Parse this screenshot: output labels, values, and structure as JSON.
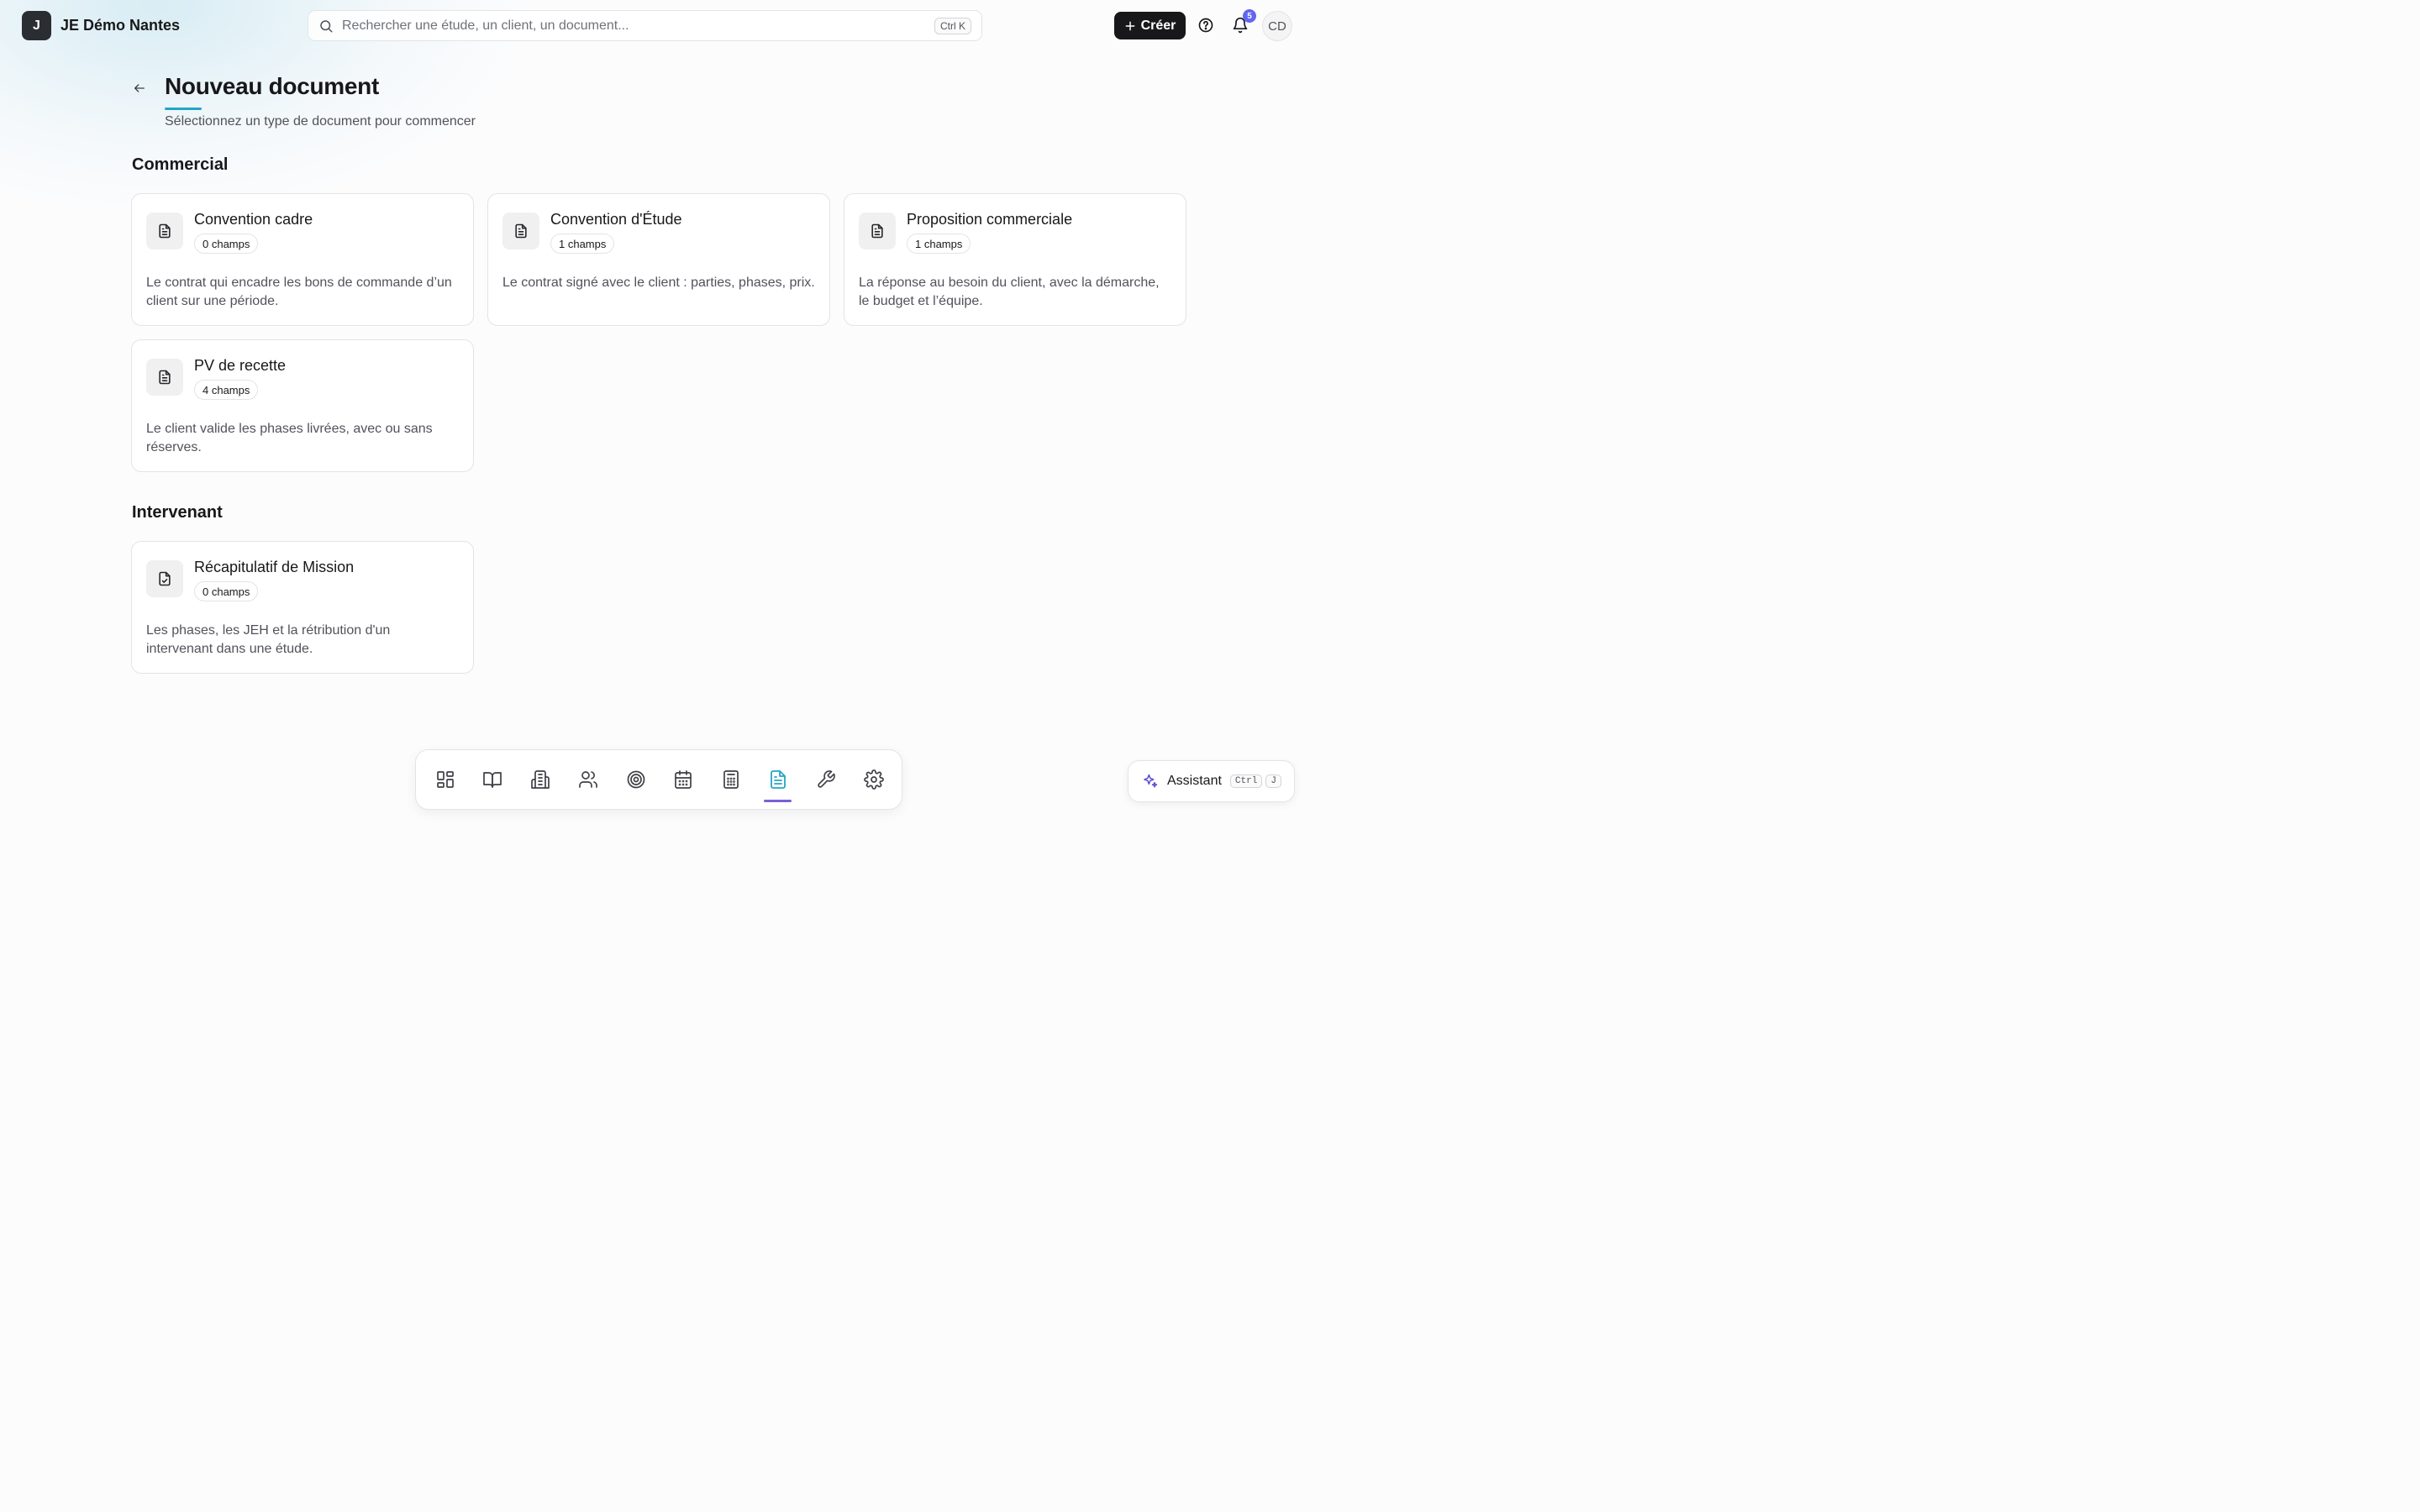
{
  "brand": {
    "logo_letter": "J",
    "name": "JE Démo Nantes"
  },
  "search": {
    "placeholder": "Rechercher une étude, un client, un document...",
    "shortcut": "Ctrl K"
  },
  "header": {
    "create_label": "Créer",
    "notifications_count": "5",
    "avatar_initials": "CD"
  },
  "page": {
    "title": "Nouveau document",
    "subtitle": "Sélectionnez un type de document pour commencer"
  },
  "sections": [
    {
      "title": "Commercial",
      "cards": [
        {
          "title": "Convention cadre",
          "badge": "0 champs",
          "description": "Le contrat qui encadre les bons de commande d’un client sur une période.",
          "icon": "file-text-icon"
        },
        {
          "title": "Convention d'Étude",
          "badge": "1 champs",
          "description": "Le contrat signé avec le client : parties, phases, prix.",
          "icon": "file-text-icon"
        },
        {
          "title": "Proposition commerciale",
          "badge": "1 champs",
          "description": "La réponse au besoin du client, avec la démarche, le budget et l’équipe.",
          "icon": "file-text-icon"
        },
        {
          "title": "PV de recette",
          "badge": "4 champs",
          "description": "Le client valide les phases livrées, avec ou sans réserves.",
          "icon": "file-text-icon"
        }
      ]
    },
    {
      "title": "Intervenant",
      "cards": [
        {
          "title": "Récapitulatif de Mission",
          "badge": "0 champs",
          "description": "Les phases, les JEH et la rétribution d'un intervenant dans une étude.",
          "icon": "file-check-icon"
        }
      ]
    }
  ],
  "dock": {
    "items": [
      "dashboard-icon",
      "book-icon",
      "building-icon",
      "users-icon",
      "target-icon",
      "calendar-icon",
      "calculator-icon",
      "file-text-icon",
      "wrench-icon",
      "settings-icon"
    ],
    "active": "file-text-icon"
  },
  "assistant": {
    "label": "Assistant",
    "shortcut_1": "Ctrl",
    "shortcut_2": "J"
  },
  "colors": {
    "accent": "#22a6c6",
    "active_indicator": "#7c5fd6",
    "badge": "#6366f1",
    "primary": "#18181b"
  }
}
